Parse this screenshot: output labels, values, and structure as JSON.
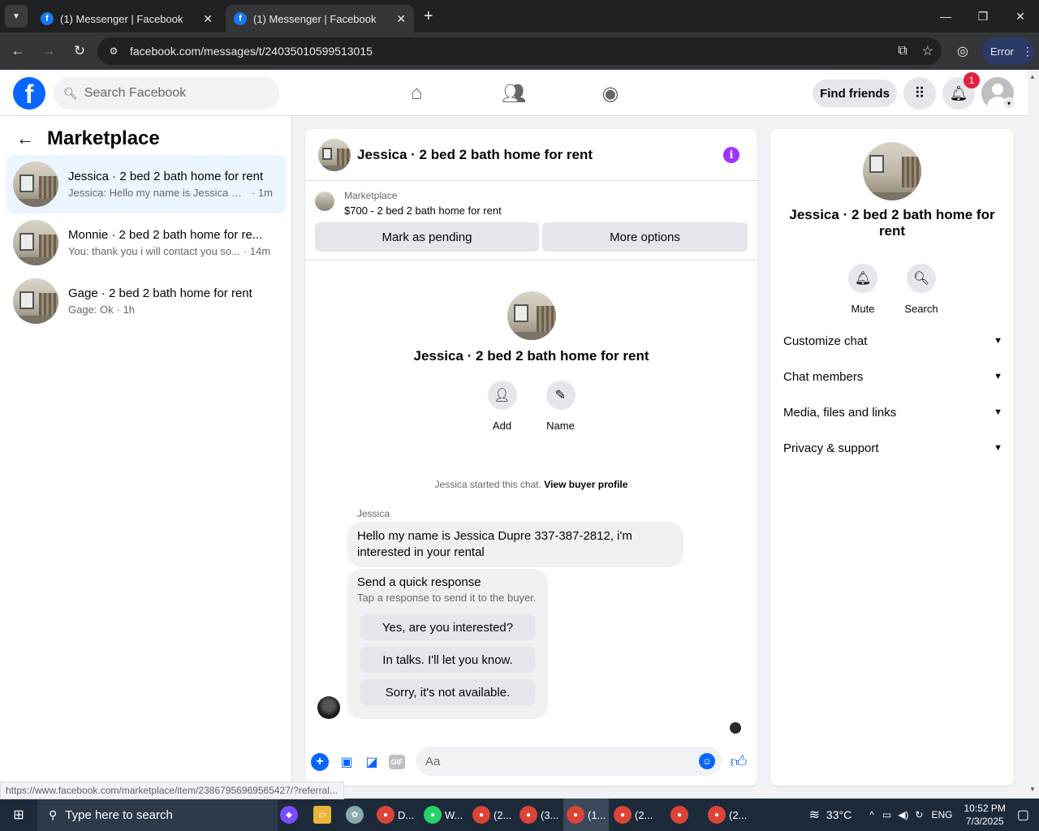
{
  "browser": {
    "tabs": [
      {
        "title": "(1) Messenger | Facebook",
        "favicon": "f"
      },
      {
        "title": "(1) Messenger | Facebook",
        "favicon": "f"
      }
    ],
    "url": "facebook.com/messages/t/24035010599513015",
    "error_label": "Error",
    "status_url": "https://www.facebook.com/marketplace/item/2386795696956542​7/?referral..."
  },
  "header": {
    "logo": "f",
    "search_placeholder": "Search Facebook",
    "find_friends": "Find friends",
    "notification_count": "1"
  },
  "sidebar": {
    "title": "Marketplace",
    "conversations": [
      {
        "name": "Jessica · 2 bed 2 bath home for rent",
        "preview": "Jessica: Hello my name is Jessica Dup...",
        "time": "· 1m"
      },
      {
        "name": "Monnie · 2 bed 2 bath home for re...",
        "preview": "You: thank you i will contact you so...",
        "time": "· 14m"
      },
      {
        "name": "Gage · 2 bed 2 bath home for rent",
        "preview": "Gage: Ok",
        "time": "· 1h"
      }
    ]
  },
  "chat": {
    "title": "Jessica · 2 bed 2 bath home for rent",
    "listing_label": "Marketplace",
    "listing_price": "$700 - 2 bed 2 bath home for rent",
    "mark_pending": "Mark as pending",
    "more_options": "More options",
    "profile_name": "Jessica · 2 bed 2 bath home for rent",
    "add_label": "Add",
    "name_label": "Name",
    "started_text": "Jessica started this chat.",
    "view_profile": "View buyer profile",
    "sender": "Jessica",
    "message": "Hello my name is Jessica Dupre 337-387-2812, i'm interested in your rental",
    "quick_title": "Send a quick response",
    "quick_sub": "Tap a response to send it to the buyer.",
    "quick_responses": [
      "Yes, are you interested?",
      "In talks. I'll let you know.",
      "Sorry, it's not available."
    ],
    "input_placeholder": "Aa",
    "gif_label": "GIF"
  },
  "info_panel": {
    "name": "Jessica · 2 bed 2 bath home for rent",
    "mute": "Mute",
    "search": "Search",
    "sections": [
      "Customize chat",
      "Chat members",
      "Media, files and links",
      "Privacy & support"
    ]
  },
  "taskbar": {
    "search_placeholder": "Type here to search",
    "apps": [
      {
        "label": "D..."
      },
      {
        "label": "W..."
      },
      {
        "label": "(2..."
      },
      {
        "label": "(3..."
      },
      {
        "label": "(1..."
      },
      {
        "label": "(2..."
      },
      {
        "label": ""
      },
      {
        "label": "(2..."
      }
    ],
    "temperature": "33°C",
    "language": "ENG",
    "time": "10:52 PM",
    "date": "7/3/2025"
  }
}
